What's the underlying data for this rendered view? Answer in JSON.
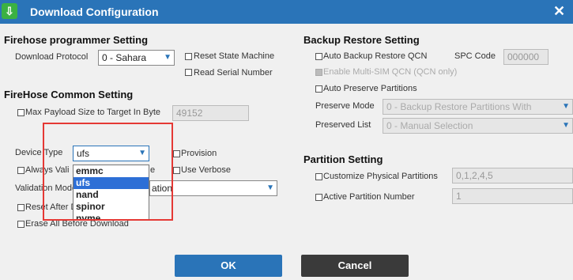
{
  "window": {
    "title": "Download Configuration",
    "close_glyph": "✕",
    "app_icon": "download-arrow-icon"
  },
  "firehose_programmer": {
    "heading": "Firehose programmer Setting",
    "protocol_label": "Download Protocol",
    "protocol_value": "0 - Sahara",
    "reset_state_machine": "Reset State Machine",
    "read_serial_number": "Read Serial Number"
  },
  "firehose_common": {
    "heading": "FireHose Common Setting",
    "max_payload_label": "Max Payload Size to Target In Byte",
    "max_payload_value": "49152",
    "device_type_label": "Device Type",
    "device_type_value": "ufs",
    "device_type_options": [
      "emmc",
      "ufs",
      "nand",
      "spinor",
      "nvme"
    ],
    "provision": "Provision",
    "always_validate": "Always Vali",
    "always_validate_tail": "e",
    "use_verbose": "Use Verbose",
    "validation_mode_label": "Validation Mode",
    "validation_mode_value": "ation",
    "reset_after": "Reset After D",
    "erase_all": "Erase All Before Download"
  },
  "backup_restore": {
    "heading": "Backup Restore Setting",
    "auto_backup": "Auto Backup Restore QCN",
    "spc_label": "SPC Code",
    "spc_value": "000000",
    "enable_multi_sim": "Enable Multi-SIM QCN (QCN only)",
    "auto_preserve": "Auto Preserve Partitions",
    "preserve_mode_label": "Preserve Mode",
    "preserve_mode_value": "0 - Backup Restore Partitions With",
    "preserved_list_label": "Preserved List",
    "preserved_list_value": "0 - Manual Selection"
  },
  "partition": {
    "heading": "Partition Setting",
    "customize_physical": "Customize Physical Partitions",
    "customize_value": "0,1,2,4,5",
    "active_partition": "Active Partition Number",
    "active_value": "1"
  },
  "buttons": {
    "ok": "OK",
    "cancel": "Cancel"
  },
  "colors": {
    "titlebar": "#2a74b8",
    "ok_button": "#2a74b8",
    "cancel_button": "#3a3a3a",
    "highlight_box": "#e53935",
    "selected_option": "#2d6fd6"
  }
}
